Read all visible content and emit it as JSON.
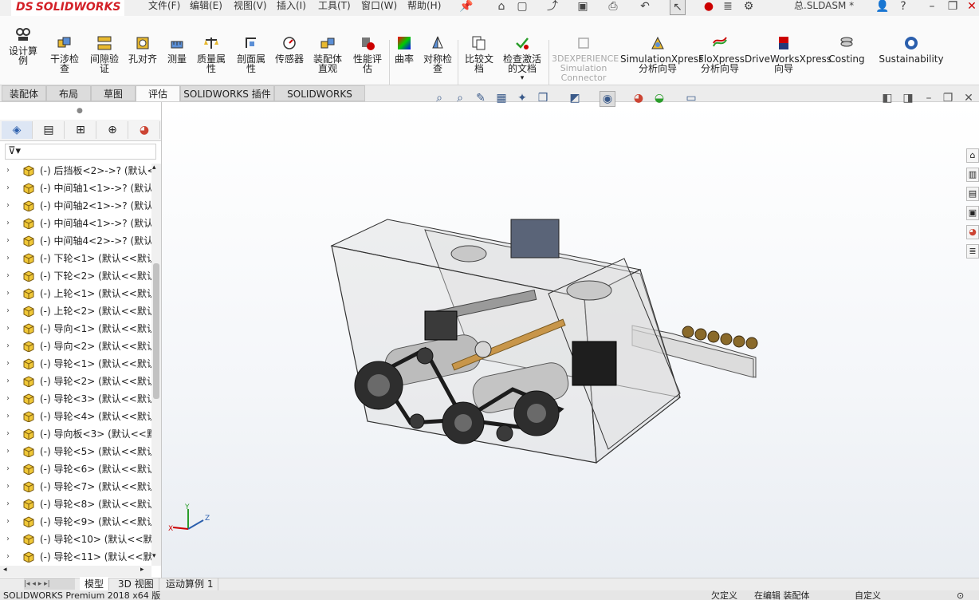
{
  "app": {
    "logo_text": "SOLIDWORKS",
    "logo_mark": "DS",
    "document_title": "总.SLDASM *"
  },
  "menu": [
    "文件(F)",
    "编辑(E)",
    "视图(V)",
    "插入(I)",
    "工具(T)",
    "窗口(W)",
    "帮助(H)"
  ],
  "ribbon": {
    "tools": [
      {
        "label": "设计算例",
        "icon": "design-study-icon"
      },
      {
        "label": "干涉检查",
        "icon": "interference-check-icon"
      },
      {
        "label": "间隙验证",
        "icon": "clearance-verification-icon"
      },
      {
        "label": "孔对齐",
        "icon": "hole-alignment-icon"
      },
      {
        "label": "测量",
        "icon": "measure-icon"
      },
      {
        "label": "质量属性",
        "icon": "mass-properties-icon"
      },
      {
        "label": "剖面属性",
        "icon": "section-properties-icon"
      },
      {
        "label": "传感器",
        "icon": "sensor-icon"
      },
      {
        "label": "装配体直观",
        "icon": "assembly-visualization-icon"
      },
      {
        "label": "性能评估",
        "icon": "performance-evaluation-icon"
      },
      {
        "label": "曲率",
        "icon": "curvature-icon"
      },
      {
        "label": "对称检查",
        "icon": "symmetry-check-icon"
      },
      {
        "label": "比较文档",
        "icon": "compare-documents-icon"
      },
      {
        "label": "检查激活的文档",
        "icon": "check-active-document-icon"
      },
      {
        "label": "3DEXPERIENCE Simulation Connector",
        "icon": "3dexperience-icon"
      },
      {
        "label": "SimulationXpress 分析向导",
        "icon": "simulationxpress-icon"
      },
      {
        "label": "FloXpress 分析向导",
        "icon": "floxpress-icon"
      },
      {
        "label": "DriveWorksXpress 向导",
        "icon": "driveworksxpress-icon"
      },
      {
        "label": "Costing",
        "icon": "costing-icon"
      },
      {
        "label": "Sustainability",
        "icon": "sustainability-icon"
      }
    ]
  },
  "command_tabs": [
    "装配体",
    "布局",
    "草图",
    "评估",
    "SOLIDWORKS 插件",
    "SOLIDWORKS MBD"
  ],
  "active_tab": "评估",
  "tree": {
    "items": [
      "(-) 后挡板<2>->? (默认<",
      "(-) 中间轴1<1>->? (默认",
      "(-) 中间轴2<1>->? (默认",
      "(-) 中间轴4<1>->? (默认",
      "(-) 中间轴4<2>->? (默认",
      "(-) 下轮<1> (默认<<默认",
      "(-) 下轮<2> (默认<<默认",
      "(-) 上轮<1> (默认<<默认",
      "(-) 上轮<2> (默认<<默认",
      "(-) 导向<1> (默认<<默认",
      "(-) 导向<2> (默认<<默认",
      "(-) 导轮<1> (默认<<默认",
      "(-) 导轮<2> (默认<<默认",
      "(-) 导轮<3> (默认<<默认",
      "(-) 导轮<4> (默认<<默认",
      "(-) 导向板<3> (默认<<默",
      "(-) 导轮<5> (默认<<默认",
      "(-) 导轮<6> (默认<<默认",
      "(-) 导轮<7> (默认<<默认",
      "(-) 导轮<8> (默认<<默认",
      "(-) 导轮<9> (默认<<默认",
      "(-) 导轮<10> (默认<<默",
      "(-) 导轮<11> (默认<<默"
    ]
  },
  "bottom_tabs": [
    "模型",
    "3D 视图",
    "运动算例 1"
  ],
  "status": {
    "app_version": "SOLIDWORKS Premium 2018 x64 版",
    "defined": "欠定义",
    "editing": "在编辑 装配体",
    "custom": "自定义"
  },
  "triad": {
    "x": "X",
    "y": "Y",
    "z": "Z"
  },
  "colors": {
    "brand_red": "#d32027",
    "accent_blue": "#2b5fad"
  }
}
